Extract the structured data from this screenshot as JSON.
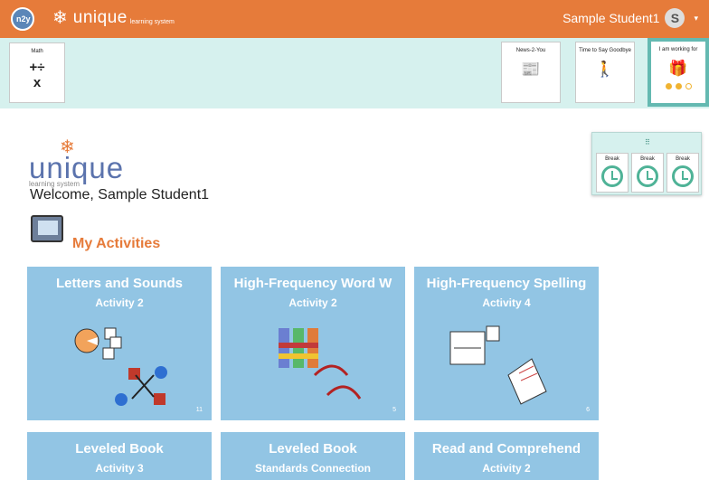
{
  "topbar": {
    "globe_text": "n2y",
    "brand_name": "unique",
    "brand_sub": "learning system",
    "user_name": "Sample Student1",
    "user_initial": "S",
    "caret": "▾"
  },
  "strip": {
    "cards": [
      {
        "label": "Math"
      },
      {
        "label": "News-2-You"
      },
      {
        "label": "Time to Say Goodbye"
      },
      {
        "label": "I am working for"
      }
    ]
  },
  "logo": {
    "word": "unique",
    "sub": "learning system"
  },
  "welcome": "Welcome, Sample Student1",
  "activities_title": "My Activities",
  "break_box": {
    "items": [
      "Break",
      "Break",
      "Break"
    ]
  },
  "tiles": [
    {
      "title": "Letters and Sounds",
      "subtitle": "Activity 2",
      "count": "11"
    },
    {
      "title": "High-Frequency Word W",
      "subtitle": "Activity 2",
      "count": "5"
    },
    {
      "title": "High-Frequency Spelling",
      "subtitle": "Activity 4",
      "count": "6"
    },
    {
      "title": "Leveled Book",
      "subtitle": "Activity 3",
      "count": ""
    },
    {
      "title": "Leveled Book",
      "subtitle": "Standards Connection",
      "count": ""
    },
    {
      "title": "Read and Comprehend",
      "subtitle": "Activity 2",
      "count": ""
    }
  ],
  "colors": {
    "accent": "#e67b3a",
    "tile": "#92c5e4",
    "strip": "#d6f1ee",
    "teal": "#64b9b1"
  }
}
